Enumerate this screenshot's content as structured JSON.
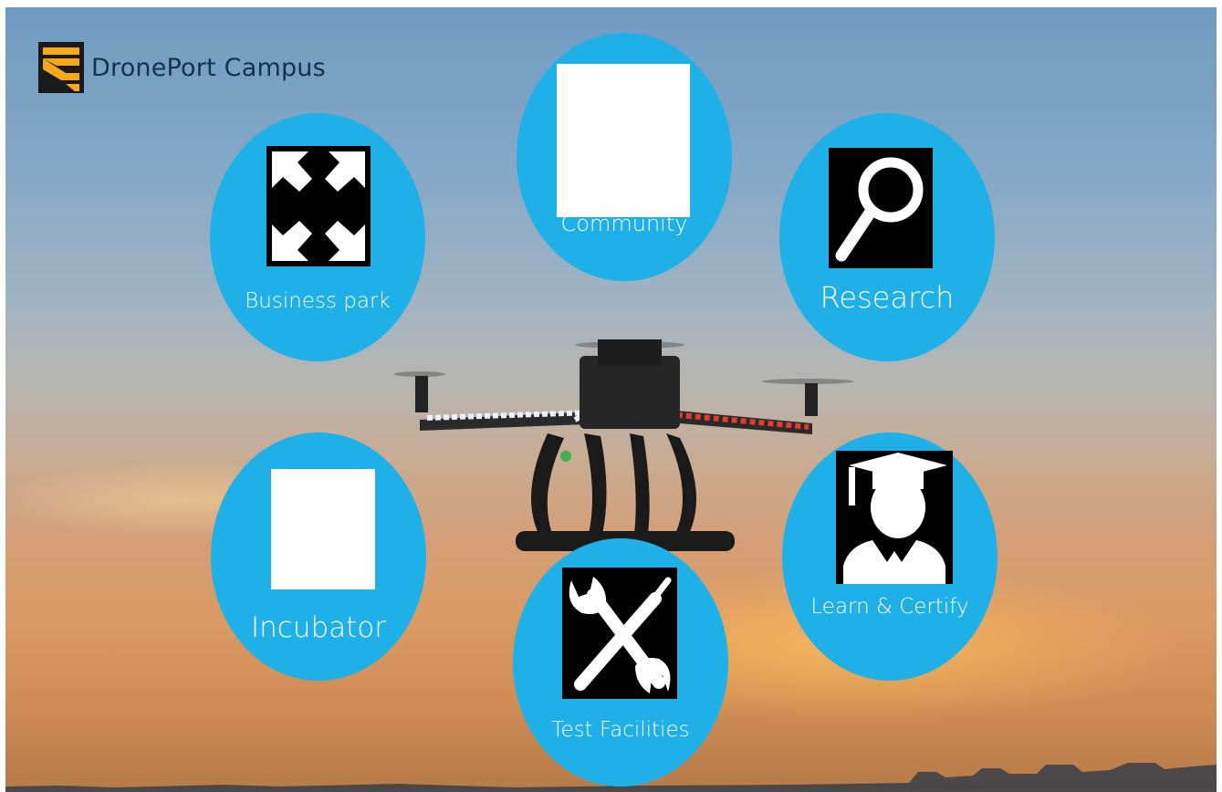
{
  "brand": {
    "name": "DronePort Campus",
    "logo_colors": {
      "dark": "#1a1a1a",
      "accent": "#f6a81c"
    }
  },
  "theme": {
    "node_color": "#1fb0e8",
    "label_color": "#ffffff"
  },
  "nodes": {
    "community": {
      "label": "Community",
      "icon": "blank-image-icon"
    },
    "business_park": {
      "label": "Business park",
      "icon": "expand-arrows-icon"
    },
    "research": {
      "label": "Research",
      "icon": "magnifier-icon"
    },
    "incubator": {
      "label": "Incubator",
      "icon": "blank-image-icon"
    },
    "learn_certify": {
      "label": "Learn & Certify",
      "icon": "graduate-icon"
    },
    "test_facilities": {
      "label": "Test Facilities",
      "icon": "tools-icon"
    }
  }
}
